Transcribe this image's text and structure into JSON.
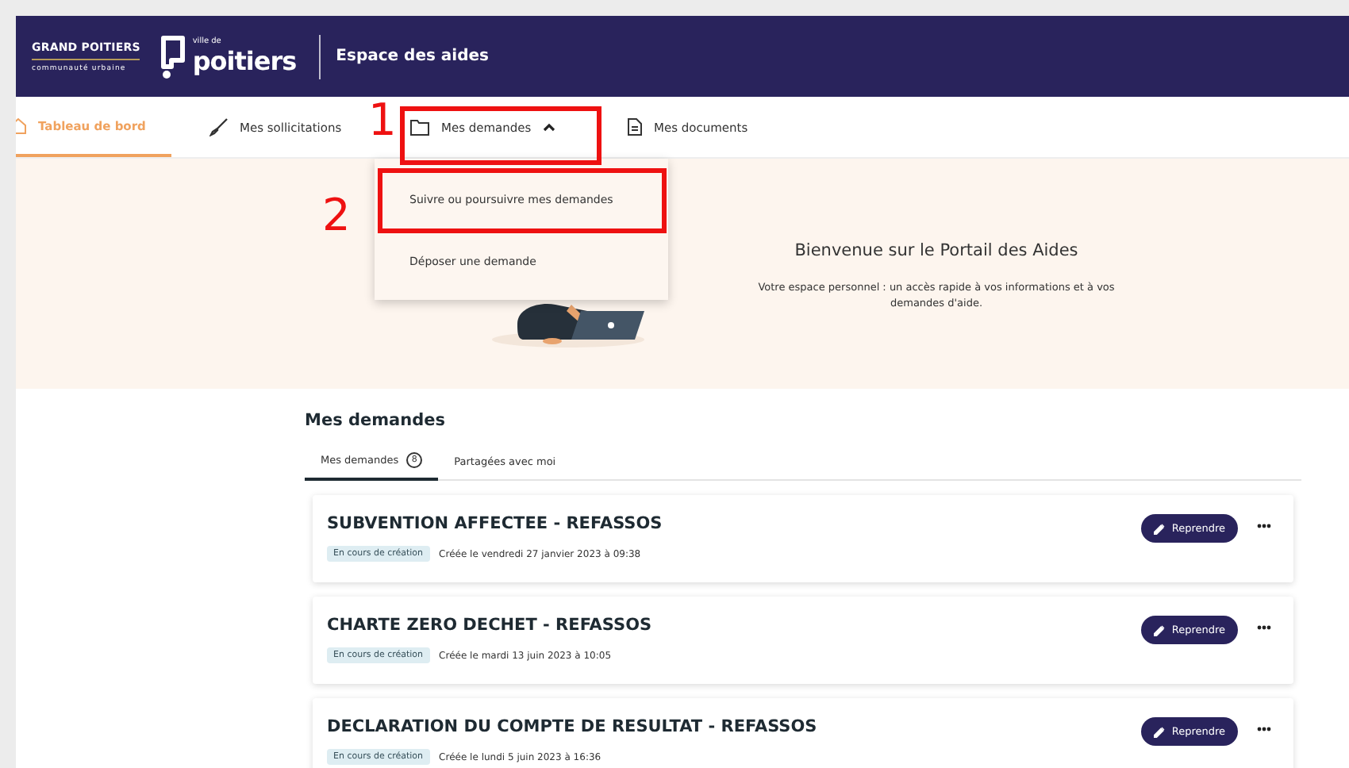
{
  "header": {
    "agglo_logo": {
      "name": "GRAND POITIERS",
      "subtitle": "communauté urbaine"
    },
    "city_logo": {
      "prefix": "ville de",
      "name": "poitiers"
    },
    "title": "Espace des aides"
  },
  "nav": [
    {
      "label": "Tableau de bord",
      "kind": "link",
      "selected": true
    },
    {
      "label": "Mes sollicitations",
      "kind": "link",
      "selected": false
    },
    {
      "label": "Mes demandes",
      "kind": "menu",
      "selected": false,
      "expanded": true
    },
    {
      "label": "Mes documents",
      "kind": "link",
      "selected": false
    }
  ],
  "dropdown": {
    "items": [
      {
        "label": "Suivre ou poursuivre mes demandes"
      },
      {
        "label": "Déposer une demande"
      }
    ]
  },
  "annotations": [
    {
      "label": "1"
    },
    {
      "label": "2"
    }
  ],
  "hero": {
    "title": "Bienvenue sur le Portail des Aides",
    "text": "Votre espace personnel : un accès rapide à vos informations et à vos demandes d'aide."
  },
  "requests": {
    "title": "Mes demandes",
    "tabs": [
      {
        "label": "Mes demandes",
        "count": "8",
        "selected": true
      },
      {
        "label": "Partagées avec moi",
        "selected": false
      }
    ],
    "items": [
      {
        "title": "SUBVENTION AFFECTEE - REFASSOS",
        "status": "En cours de création",
        "created": "Créée le vendredi 27 janvier 2023 à 09:38",
        "action": "Reprendre"
      },
      {
        "title": "CHARTE ZERO DECHET - REFASSOS",
        "status": "En cours de création",
        "created": "Créée le mardi 13 juin 2023 à 10:05",
        "action": "Reprendre"
      },
      {
        "title": "DECLARATION DU COMPTE DE RESULTAT - REFASSOS",
        "status": "En cours de création",
        "created": "Créée le lundi 5 juin 2023 à 16:36",
        "action": "Reprendre"
      }
    ]
  }
}
